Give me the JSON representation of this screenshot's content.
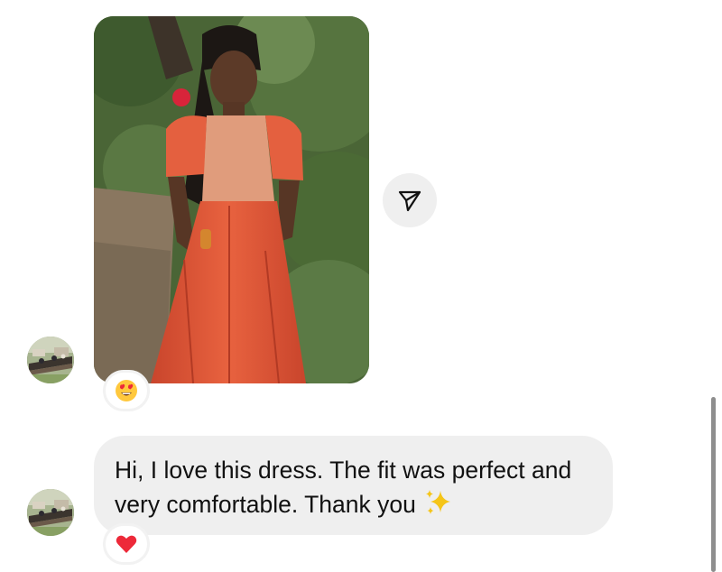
{
  "thread": {
    "photo_message": {
      "reaction_emoji": "😍"
    },
    "share_action": {
      "icon": "send-icon"
    },
    "text_message": {
      "text": "Hi, I love this dress. The fit was perfect and very comfortable. Thank you",
      "trailing_emoji": "sparkles-icon",
      "reaction_emoji": "❤️"
    }
  },
  "colors": {
    "bubble_bg": "#efefef",
    "dress": "#e05a3a",
    "foliage": "#4f6b3b",
    "heart": "#ed2939",
    "sparkle": "#f5c518"
  }
}
